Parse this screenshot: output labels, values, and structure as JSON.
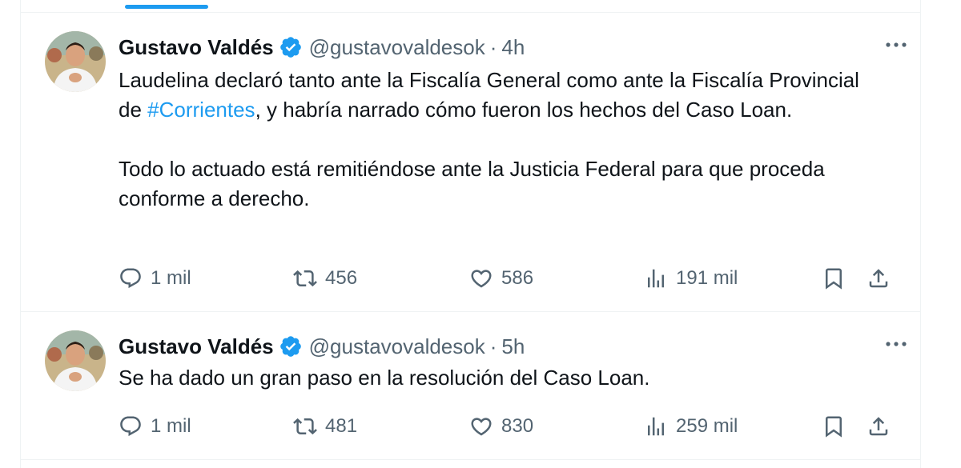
{
  "tweets": [
    {
      "author": "Gustavo Valdés",
      "handle": "@gustavovaldesok",
      "separator": "·",
      "time": "4h",
      "text_parts": {
        "p1_a": "Laudelina declaró tanto ante la Fiscalía General como ante la Fiscalía Provincial de ",
        "hashtag": "#Corrientes",
        "p1_b": ",  y habría narrado cómo fueron los hechos del Caso Loan.",
        "p2": "Todo lo actuado está remitiéndose ante la Justicia Federal para que proceda conforme a derecho."
      },
      "stats": {
        "replies": "1 mil",
        "reposts": "456",
        "likes": "586",
        "views": "191 mil"
      }
    },
    {
      "author": "Gustavo Valdés",
      "handle": "@gustavovaldesok",
      "separator": "·",
      "time": "5h",
      "text": "Se ha dado un gran paso en la resolución del Caso Loan.",
      "stats": {
        "replies": "1 mil",
        "reposts": "481",
        "likes": "830",
        "views": "259 mil"
      }
    }
  ],
  "colors": {
    "accent": "#1d9bf0",
    "secondary_text": "#536471",
    "divider": "#eff3f4"
  },
  "icons": [
    "verified-badge-icon",
    "more-icon",
    "reply-icon",
    "repost-icon",
    "like-icon",
    "views-icon",
    "bookmark-icon",
    "share-icon"
  ]
}
